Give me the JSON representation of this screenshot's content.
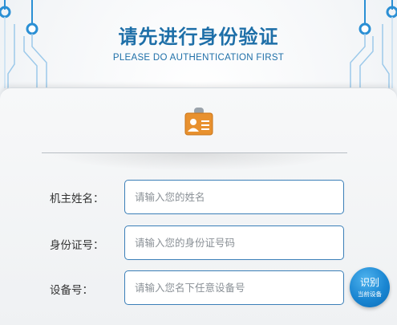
{
  "header": {
    "title": "请先进行身份验证",
    "subtitle": "PLEASE DO AUTHENTICATION FIRST"
  },
  "icons": {
    "id_card": "id-card-icon",
    "circuit_decor": "circuit-decoration"
  },
  "form": {
    "owner_name": {
      "label": "机主姓名：",
      "placeholder": "请输入您的姓名"
    },
    "id_number": {
      "label": "身份证号：",
      "placeholder": "请输入您的身份证号码"
    },
    "device_number": {
      "label": "设备号：",
      "placeholder": "请输入您名下任意设备号"
    }
  },
  "identify_button": {
    "label": "识别",
    "sublabel": "当前设备"
  },
  "colors": {
    "accent": "#1e6fa8",
    "field_border": "#3b7fb8",
    "icon_orange": "#e8912f",
    "button_blue": "#1a86d2"
  }
}
